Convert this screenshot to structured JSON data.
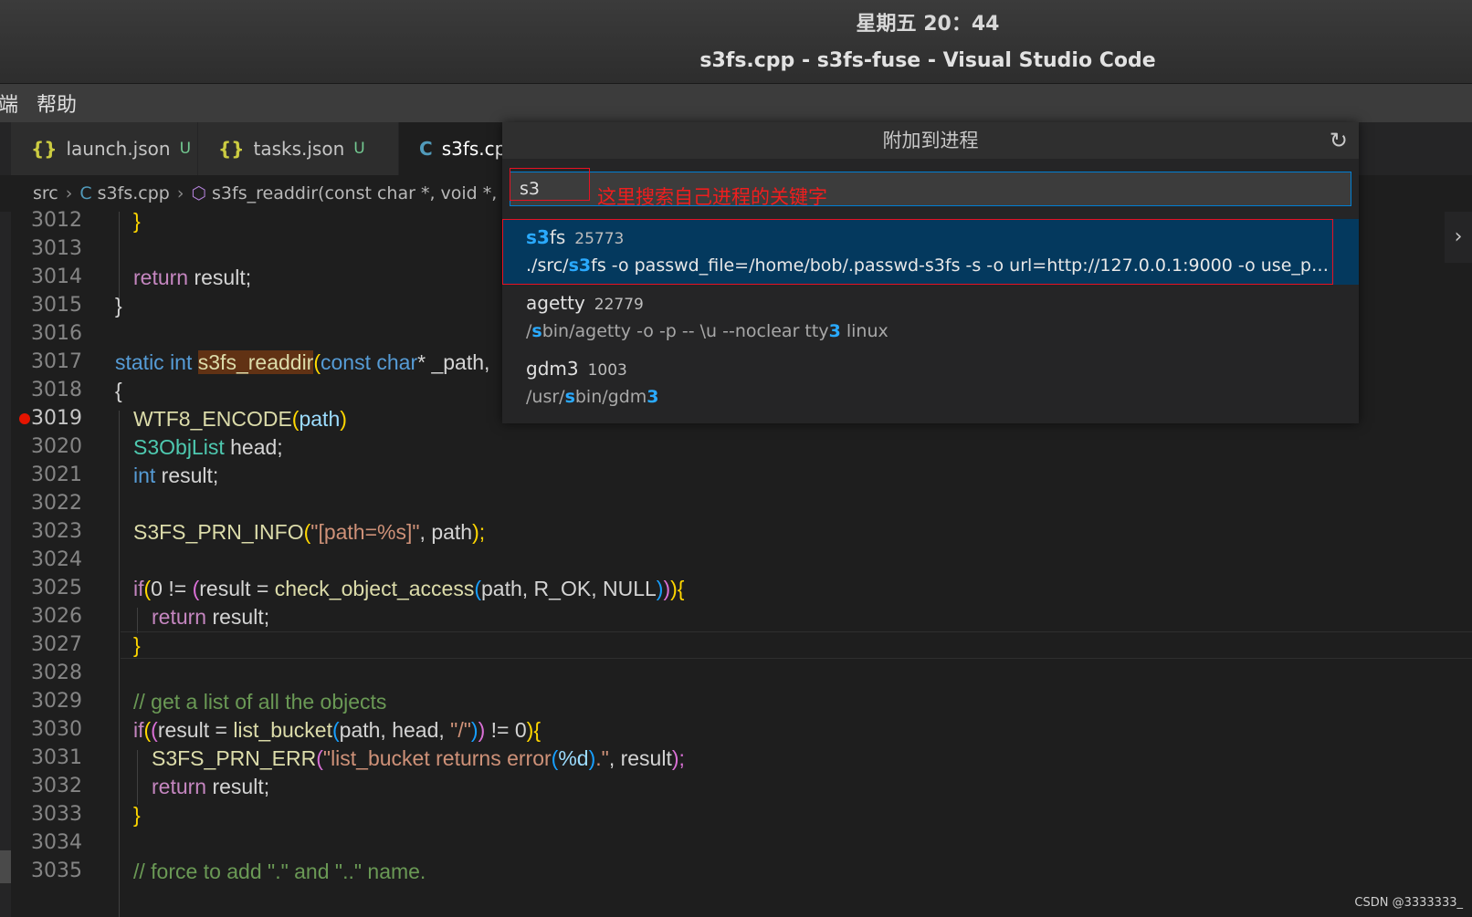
{
  "system": {
    "clock": "星期五 20：44",
    "window_title": "s3fs.cpp - s3fs-fuse - Visual Studio Code"
  },
  "menu": [
    "端",
    "帮助"
  ],
  "tabs": [
    {
      "icon": "{}",
      "label": "launch.json",
      "badge": "U"
    },
    {
      "icon": "{}",
      "label": "tasks.json",
      "badge": "U"
    },
    {
      "icon": "C",
      "label": "s3fs.cp"
    }
  ],
  "breadcrumb": {
    "folder": "src",
    "file_icon": "C",
    "file": "s3fs.cpp",
    "symbol": "s3fs_readdir(const char *, void *,"
  },
  "quick_pick": {
    "title": "附加到进程",
    "input_value": "s3",
    "annotation": "这里搜索自己进程的关键字",
    "items": [
      {
        "name_match": "s3",
        "name_rest": "fs",
        "pid": "25773",
        "detail_pre": "./src/",
        "detail_match": "s3",
        "detail_rest": "fs -o passwd_file=/home/bob/.passwd-s3fs -s -o url=http://127.0.0.1:9000 -o use_path_..."
      },
      {
        "name": "agetty",
        "pid": "22779",
        "detail_pre": "/",
        "detail_match1": "s",
        "detail_mid": "bin/agetty -o -p -- \\u --noclear tty",
        "detail_match2": "3",
        "detail_post": " linux"
      },
      {
        "name": "gdm3",
        "pid": "1003",
        "detail_pre": "/usr/",
        "detail_match1": "s",
        "detail_mid": "bin/gdm",
        "detail_match2": "3"
      }
    ]
  },
  "editor": {
    "line_numbers": [
      "3012",
      "3013",
      "3014",
      "3015",
      "3016",
      "3017",
      "3018",
      "3019",
      "3020",
      "3021",
      "3022",
      "3023",
      "3024",
      "3025",
      "3026",
      "3027",
      "3028",
      "3029",
      "3030",
      "3031",
      "3032",
      "3033",
      "3034",
      "3035"
    ],
    "breakpoint_line": "3019",
    "code": {
      "l3012": "}",
      "l3014_kw": "return",
      "l3014_rest": " result;",
      "l3015": "}",
      "l3017_kw": "static int ",
      "l3017_fn": "s3fs_readdir",
      "l3017_p": "(",
      "l3017_kw2": "const char",
      "l3017_rest": "* _path,",
      "l3018": "{",
      "l3019_fn": "WTF8_ENCODE",
      "l3019_p1": "(",
      "l3019_arg": "path",
      "l3019_p2": ")",
      "l3020_ty": "S3ObjList",
      "l3020_rest": " head;",
      "l3021_kw": "int",
      "l3021_rest": " result;",
      "l3023_fn": "S3FS_PRN_INFO",
      "l3023_p1": "(",
      "l3023_str": "\"[path=%s]\"",
      "l3023_rest": ", path",
      "l3023_p2": ");",
      "l3025_kw": "if",
      "l3025_p1": "(",
      "l3025_a": "0 != ",
      "l3025_p2": "(",
      "l3025_b": "result = ",
      "l3025_fn": "check_object_access",
      "l3025_p3": "(",
      "l3025_c": "path, R_OK, NULL",
      "l3025_p4": ")",
      "l3025_p5": ")",
      "l3025_p6": ")",
      "l3025_brace": "{",
      "l3026_kw": "return",
      "l3026_rest": " result;",
      "l3027": "}",
      "l3029": "// get a list of all the objects",
      "l3030_kw": "if",
      "l3030_p1": "(",
      "l3030_p2": "(",
      "l3030_a": "result = ",
      "l3030_fn": "list_bucket",
      "l3030_p3": "(",
      "l3030_b": "path, head, ",
      "l3030_str": "\"/\"",
      "l3030_p4": ")",
      "l3030_p5": ")",
      "l3030_c": " != 0",
      "l3030_p6": ")",
      "l3030_brace": "{",
      "l3031_fn": "S3FS_PRN_ERR",
      "l3031_p1": "(",
      "l3031_str": "\"list_bucket returns error",
      "l3031_p2": "(",
      "l3031_fmt": "%d",
      "l3031_p3": ")",
      "l3031_str2": ".\"",
      "l3031_rest": ", result",
      "l3031_p4": ");",
      "l3032_kw": "return",
      "l3032_rest": " result;",
      "l3033": "}",
      "l3035": "// force to add \".\" and \"..\" name."
    }
  },
  "watermark": "CSDN @3333333_",
  "colors": {
    "accent": "#007fd4",
    "selection": "#04395e",
    "annotation_red": "#e81123"
  }
}
